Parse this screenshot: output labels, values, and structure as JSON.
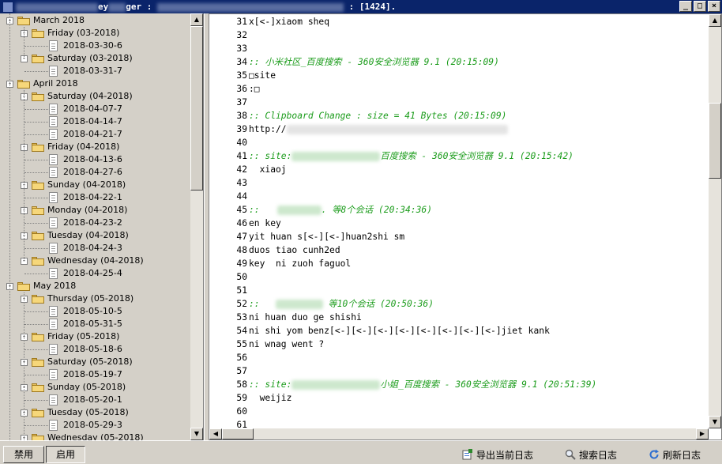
{
  "window": {
    "title_left": "ey",
    "title_mid": "ger :",
    "title_right": ": [1424].",
    "buttons": [
      "_",
      "□",
      "×"
    ]
  },
  "tree": {
    "toggle_collapsed": "+",
    "toggle_expanded": "-",
    "nodes": [
      {
        "level": 0,
        "type": "month",
        "label": "March 2018"
      },
      {
        "level": 1,
        "type": "day",
        "label": "Friday (03-2018)"
      },
      {
        "level": 2,
        "type": "file",
        "label": "2018-03-30-6"
      },
      {
        "level": 1,
        "type": "day",
        "label": "Saturday (03-2018)"
      },
      {
        "level": 2,
        "type": "file",
        "label": "2018-03-31-7"
      },
      {
        "level": 0,
        "type": "month",
        "label": "April 2018"
      },
      {
        "level": 1,
        "type": "day",
        "label": "Saturday (04-2018)"
      },
      {
        "level": 2,
        "type": "file",
        "label": "2018-04-07-7"
      },
      {
        "level": 2,
        "type": "file",
        "label": "2018-04-14-7"
      },
      {
        "level": 2,
        "type": "file",
        "label": "2018-04-21-7"
      },
      {
        "level": 1,
        "type": "day",
        "label": "Friday (04-2018)"
      },
      {
        "level": 2,
        "type": "file",
        "label": "2018-04-13-6"
      },
      {
        "level": 2,
        "type": "file",
        "label": "2018-04-27-6"
      },
      {
        "level": 1,
        "type": "day",
        "label": "Sunday (04-2018)"
      },
      {
        "level": 2,
        "type": "file",
        "label": "2018-04-22-1"
      },
      {
        "level": 1,
        "type": "day",
        "label": "Monday (04-2018)"
      },
      {
        "level": 2,
        "type": "file",
        "label": "2018-04-23-2"
      },
      {
        "level": 1,
        "type": "day",
        "label": "Tuesday (04-2018)"
      },
      {
        "level": 2,
        "type": "file",
        "label": "2018-04-24-3"
      },
      {
        "level": 1,
        "type": "day",
        "label": "Wednesday (04-2018)"
      },
      {
        "level": 2,
        "type": "file",
        "label": "2018-04-25-4"
      },
      {
        "level": 0,
        "type": "month",
        "label": "May 2018"
      },
      {
        "level": 1,
        "type": "day",
        "label": "Thursday (05-2018)"
      },
      {
        "level": 2,
        "type": "file",
        "label": "2018-05-10-5"
      },
      {
        "level": 2,
        "type": "file",
        "label": "2018-05-31-5"
      },
      {
        "level": 1,
        "type": "day",
        "label": "Friday (05-2018)"
      },
      {
        "level": 2,
        "type": "file",
        "label": "2018-05-18-6"
      },
      {
        "level": 1,
        "type": "day",
        "label": "Saturday (05-2018)"
      },
      {
        "level": 2,
        "type": "file",
        "label": "2018-05-19-7"
      },
      {
        "level": 1,
        "type": "day",
        "label": "Sunday (05-2018)"
      },
      {
        "level": 2,
        "type": "file",
        "label": "2018-05-20-1"
      },
      {
        "level": 1,
        "type": "day",
        "label": "Tuesday (05-2018)"
      },
      {
        "level": 2,
        "type": "file",
        "label": "2018-05-29-3"
      },
      {
        "level": 1,
        "type": "day",
        "label": "Wednesday (05-2018)"
      }
    ]
  },
  "editor": {
    "lines": [
      {
        "n": "31",
        "text": "x[<-]xiaom sheq",
        "kind": "text"
      },
      {
        "n": "32",
        "text": "",
        "kind": "text"
      },
      {
        "n": "33",
        "text": "",
        "kind": "text"
      },
      {
        "n": "34",
        "text": ":: 小米社区_百度搜索 - 360安全浏览器 9.1 (20:15:09)",
        "kind": "comment"
      },
      {
        "n": "35",
        "text": "□site",
        "kind": "text"
      },
      {
        "n": "36",
        "text": ":□",
        "kind": "text"
      },
      {
        "n": "37",
        "text": "",
        "kind": "text"
      },
      {
        "n": "38",
        "text": ":: Clipboard Change : size = 41 Bytes (20:15:09)",
        "kind": "comment"
      },
      {
        "n": "39",
        "text": "http://",
        "kind": "text",
        "redact_after": 280
      },
      {
        "n": "40",
        "text": "",
        "kind": "text"
      },
      {
        "n": "41",
        "text": ":: site:",
        "kind": "comment",
        "redact_after": 112,
        "suffix": "百度搜索 - 360安全浏览器 9.1 (20:15:42)"
      },
      {
        "n": "42",
        "text": "  xiaoj",
        "kind": "text"
      },
      {
        "n": "43",
        "text": "",
        "kind": "text"
      },
      {
        "n": "44",
        "text": "",
        "kind": "text"
      },
      {
        "n": "45",
        "text": "::",
        "kind": "comment",
        "redact_after": 56,
        "pad_before": 22,
        "suffix": ". 等8个会话 (20:34:36)"
      },
      {
        "n": "46",
        "text": "en key",
        "kind": "text"
      },
      {
        "n": "47",
        "text": "yit huan s[<-][<-]huan2shi sm",
        "kind": "text"
      },
      {
        "n": "48",
        "text": "duos tiao cunh2ed",
        "kind": "text"
      },
      {
        "n": "49",
        "text": "key  ni zuoh faguol",
        "kind": "text"
      },
      {
        "n": "50",
        "text": "",
        "kind": "text"
      },
      {
        "n": "51",
        "text": "",
        "kind": "text"
      },
      {
        "n": "52",
        "text": "::",
        "kind": "comment",
        "redact_after": 60,
        "pad_before": 20,
        "suffix": " 等10个会话 (20:50:36)"
      },
      {
        "n": "53",
        "text": "ni huan duo ge shishi",
        "kind": "text"
      },
      {
        "n": "54",
        "text": "ni shi yom benz[<-][<-][<-][<-][<-][<-][<-][<-]jiet kank",
        "kind": "text"
      },
      {
        "n": "55",
        "text": "ni wnag went ?",
        "kind": "text"
      },
      {
        "n": "56",
        "text": "",
        "kind": "text"
      },
      {
        "n": "57",
        "text": "",
        "kind": "text"
      },
      {
        "n": "58",
        "text": ":: site:",
        "kind": "comment",
        "redact_after": 112,
        "suffix": "小姐_百度搜索 - 360安全浏览器 9.1 (20:51:39)"
      },
      {
        "n": "59",
        "text": "  weijiz",
        "kind": "text"
      },
      {
        "n": "60",
        "text": "",
        "kind": "text"
      },
      {
        "n": "61",
        "text": "",
        "kind": "text"
      }
    ]
  },
  "statusbar": {
    "disable_label": "禁用",
    "enable_label": "启用",
    "export_label": "导出当前日志",
    "search_label": "搜索日志",
    "refresh_label": "刷新日志"
  },
  "colors": {
    "comment": "#1b9c1b",
    "titlebar": "#0a246a",
    "face": "#d4d0c8"
  },
  "icons": {
    "export": "export-log-icon",
    "search": "magnifier-icon",
    "refresh": "refresh-icon"
  }
}
